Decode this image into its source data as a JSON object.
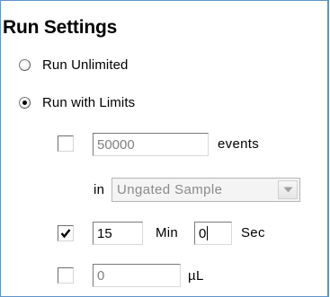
{
  "panel": {
    "title": "Run Settings",
    "run_unlimited": {
      "label": "Run Unlimited",
      "selected": false
    },
    "run_with_limits": {
      "label": "Run with Limits",
      "selected": true
    },
    "events_limit": {
      "checked": false,
      "value": "50000",
      "unit_label": "events",
      "in_label": "in",
      "gate_select": {
        "selected": "Ungated Sample"
      }
    },
    "time_limit": {
      "checked": true,
      "minutes_value": "15",
      "minutes_label": "Min",
      "seconds_value": "0",
      "seconds_label": "Sec"
    },
    "volume_limit": {
      "checked": false,
      "value": "0",
      "unit_label": "µL"
    }
  }
}
